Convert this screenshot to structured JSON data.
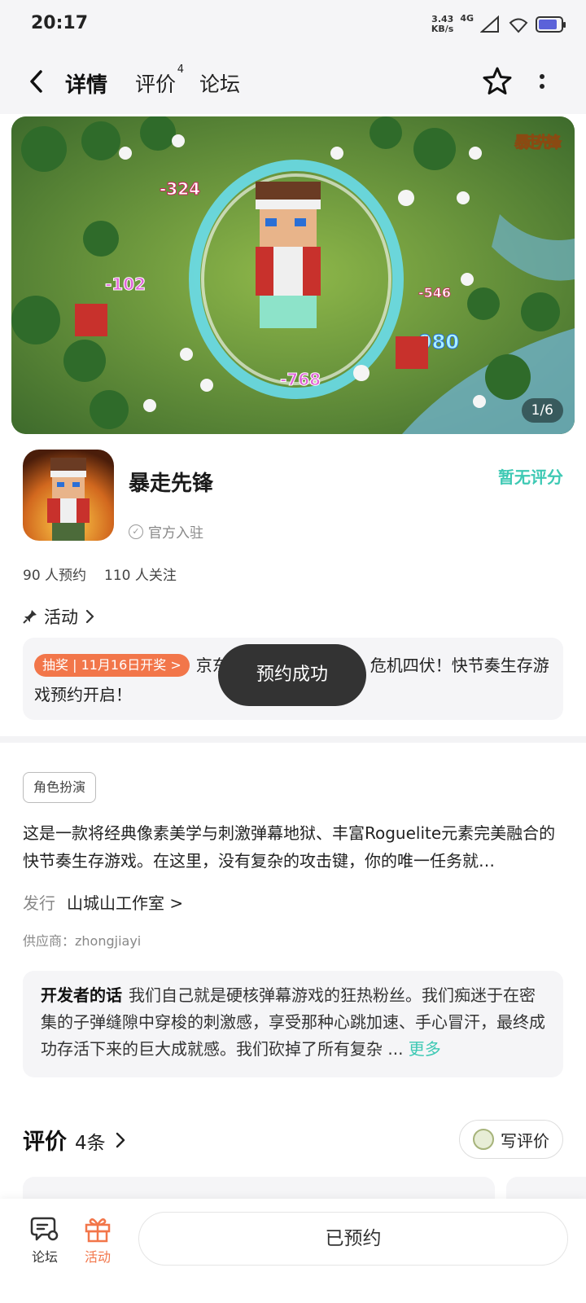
{
  "status": {
    "time": "20:17",
    "speed_value": "3.43",
    "speed_unit": "KB/s",
    "network": "4G",
    "battery_level": 0.85
  },
  "header": {
    "tabs": [
      {
        "label": "详情",
        "active": true
      },
      {
        "label": "评价",
        "badge": "4"
      },
      {
        "label": "论坛"
      }
    ]
  },
  "banner": {
    "counter": "1/6",
    "logo_text": "暴走先锋",
    "damage_numbers": [
      "-324",
      "-102",
      "-546",
      "-980",
      "-768"
    ]
  },
  "game": {
    "name": "暴走先锋",
    "official": "官方入驻",
    "rating": "暂无评分",
    "reservations": "90 人预约",
    "followers": "110 人关注"
  },
  "activity": {
    "title": "活动",
    "badge": "抽奖 | 11月16日开奖 >",
    "text": "京东...危机四伏！快节奏生存游戏预约开启！",
    "text_visible_start": "京东",
    "text_visible_end": "危机四伏！快节奏生存游戏预约开启！"
  },
  "toast": "预约成功",
  "details": {
    "tag": "角色扮演",
    "description": "这是一款将经典像素美学与刺激弹幕地狱、丰富Roguelite元素完美融合的快节奏生存游戏。在这里，没有复杂的攻击键，你的唯一任务就…",
    "publisher_label": "发行",
    "publisher_name": "山城山工作室 >",
    "supplier": "供应商：zhongjiayi"
  },
  "developer_note": {
    "label": "开发者的话",
    "text": "我们自己就是硬核弹幕游戏的狂热粉丝。我们痴迷于在密集的子弹缝隙中穿梭的刺激感，享受那种心跳加速、手心冒汗，最终成功存活下来的巨大成就感。我们砍掉了所有复杂 ...",
    "more": "更多"
  },
  "reviews": {
    "title": "评价",
    "count": "4条",
    "write_label": "写评价"
  },
  "bottom_bar": {
    "forum_label": "论坛",
    "activity_label": "活动",
    "reserved_label": "已预约"
  },
  "colors": {
    "accent": "#3ec9b4",
    "orange": "#f2764a",
    "toast_bg": "#333333"
  }
}
